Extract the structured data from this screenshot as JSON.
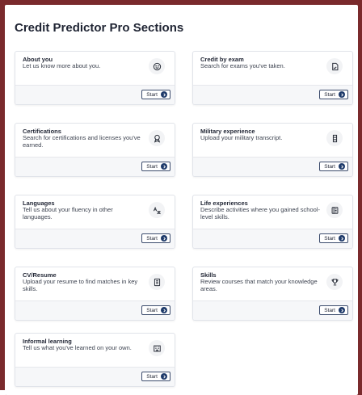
{
  "page": {
    "title": "Credit Predictor Pro Sections"
  },
  "start_label": "Start",
  "colors": {
    "header_background": "#7a2a2c",
    "button_arrow": "#1e3a6a",
    "card_border": "#e1e4ea"
  },
  "sections": [
    {
      "title": "About you",
      "description": "Let us know more about you.",
      "icon": "smile-icon"
    },
    {
      "title": "Credit by exam",
      "description": "Search for exams you've taken.",
      "icon": "document-icon"
    },
    {
      "title": "Certifications",
      "description": "Search for certifications and licenses you've earned.",
      "icon": "award-icon"
    },
    {
      "title": "Military experience",
      "description": "Upload your military transcript.",
      "icon": "dog-tag-icon"
    },
    {
      "title": "Languages",
      "description": "Tell us about your fluency in other languages.",
      "icon": "translate-icon"
    },
    {
      "title": "Life experiences",
      "description": "Describe activities where you gained school-level skills.",
      "icon": "notebook-icon"
    },
    {
      "title": "CV/Resume",
      "description": "Upload your resume to find matches in key skills.",
      "icon": "resume-icon"
    },
    {
      "title": "Skills",
      "description": "Review courses that match your knowledge areas.",
      "icon": "trophy-icon"
    },
    {
      "title": "Informal learning",
      "description": "Tell us what you've learned on your own.",
      "icon": "building-icon"
    }
  ]
}
